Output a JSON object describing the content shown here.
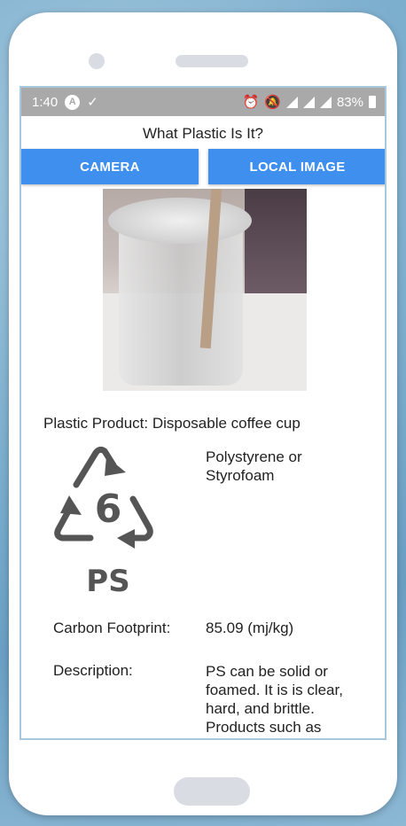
{
  "status_bar": {
    "time": "1:40",
    "app_badge": "A",
    "battery": "83%"
  },
  "app": {
    "title": "What Plastic Is It?",
    "camera_button": "CAMERA",
    "local_image_button": "LOCAL IMAGE"
  },
  "result": {
    "product": "Plastic Product: Disposable coffee cup",
    "code_number": "6",
    "code_abbrev": "PS",
    "material": "Polystyrene or Styrofoam",
    "carbon_label": "Carbon Footprint:",
    "carbon_value": "85.09 (mj/kg)",
    "description_label": "Description:",
    "description_value": "PS can be solid or foamed. It is is clear, hard, and brittle. Products such as"
  },
  "colors": {
    "button": "#3f8fef",
    "status_bar": "#a9a9a9",
    "recycle_symbol": "#555555"
  }
}
